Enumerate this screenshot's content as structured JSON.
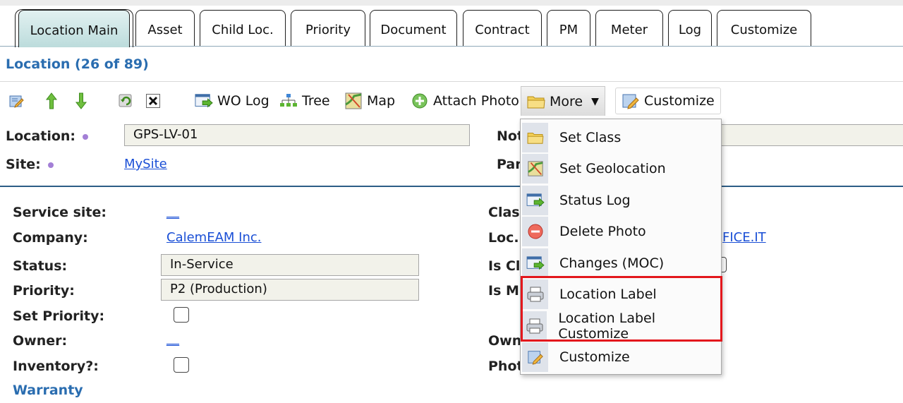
{
  "tabs": [
    {
      "label": "Location Main",
      "active": true
    },
    {
      "label": "Asset"
    },
    {
      "label": "Child Loc."
    },
    {
      "label": "Priority"
    },
    {
      "label": "Document"
    },
    {
      "label": "Contract"
    },
    {
      "label": "PM"
    },
    {
      "label": "Meter"
    },
    {
      "label": "Log"
    },
    {
      "label": "Customize"
    }
  ],
  "section": {
    "title": "Location (26 of 89)"
  },
  "toolbar": {
    "wo_log": "WO Log",
    "tree": "Tree",
    "map": "Map",
    "attach_photo": "Attach Photo",
    "more": "More",
    "customize": "Customize"
  },
  "header_fields": {
    "location_label": "Location:",
    "location_value": "GPS-LV-01",
    "site_label": "Site:",
    "site_value": "MySite",
    "notes_label_partial": "Not",
    "parent_label_partial": "Par"
  },
  "fields": {
    "service_site_label": "Service site:",
    "service_site_value": "__",
    "company_label": "Company:",
    "company_value": "CalemEAM Inc.",
    "status_label": "Status:",
    "status_value": "In-Service",
    "priority_label": "Priority:",
    "priority_value": "P2 (Production)",
    "set_priority_label": "Set Priority:",
    "owner_label": "Owner:",
    "owner_value": "__",
    "inventory_label": "Inventory?:",
    "warranty_link": "Warranty",
    "class_label_partial": "Clas",
    "loc_label_partial": "Loc.",
    "loc_value_partial": "FICE.IT",
    "is_cr_partial": "Is Cl",
    "is_m_partial": "Is M",
    "own_partial": "Own",
    "phot_partial": "Phot"
  },
  "more_menu": {
    "items": [
      {
        "label": "Set Class",
        "icon": "folder-icon"
      },
      {
        "label": "Set Geolocation",
        "icon": "map-icon"
      },
      {
        "label": "Status Log",
        "icon": "log-arrow-icon"
      },
      {
        "label": "Delete Photo",
        "icon": "delete-circle-icon"
      },
      {
        "label": "Changes (MOC)",
        "icon": "log-arrow-icon"
      },
      {
        "label": "Location Label",
        "icon": "printer-icon"
      },
      {
        "label": "Location Label Customize",
        "icon": "printer-icon"
      },
      {
        "label": "Customize",
        "icon": "customize-pencil-icon"
      }
    ]
  },
  "colors": {
    "accent_blue": "#2a6db0",
    "link_blue": "#1a4fd6",
    "highlight_red": "#e3171c",
    "active_tab": "#c9e4e4"
  }
}
